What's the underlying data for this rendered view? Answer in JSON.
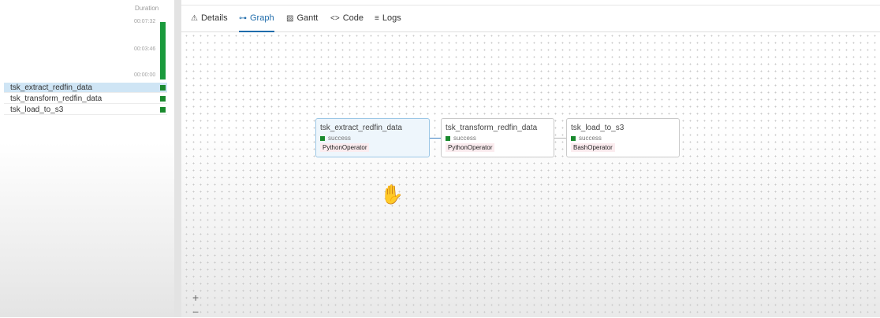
{
  "sidebar": {
    "duration_label": "Duration",
    "ticks": [
      "00:07:32",
      "00:03:46",
      "00:00:00"
    ],
    "tasks": [
      {
        "name": "tsk_extract_redfin_data",
        "selected": true
      },
      {
        "name": "tsk_transform_redfin_data",
        "selected": false
      },
      {
        "name": "tsk_load_to_s3",
        "selected": false
      }
    ]
  },
  "tabs": [
    {
      "icon": "⚠",
      "label": "Details"
    },
    {
      "icon": "⊶",
      "label": "Graph"
    },
    {
      "icon": "▨",
      "label": "Gantt"
    },
    {
      "icon": "<>",
      "label": "Code"
    },
    {
      "icon": "≡",
      "label": "Logs"
    }
  ],
  "graph": {
    "nodes": [
      {
        "name": "tsk_extract_redfin_data",
        "status": "success",
        "operator": "PythonOperator"
      },
      {
        "name": "tsk_transform_redfin_data",
        "status": "success",
        "operator": "PythonOperator"
      },
      {
        "name": "tsk_load_to_s3",
        "status": "success",
        "operator": "BashOperator"
      }
    ]
  },
  "zoom": {
    "in": "+",
    "out": "−"
  },
  "colors": {
    "accent": "#1f6cab",
    "success": "#1a8a2e",
    "selected_bg": "#cfe5f5"
  }
}
